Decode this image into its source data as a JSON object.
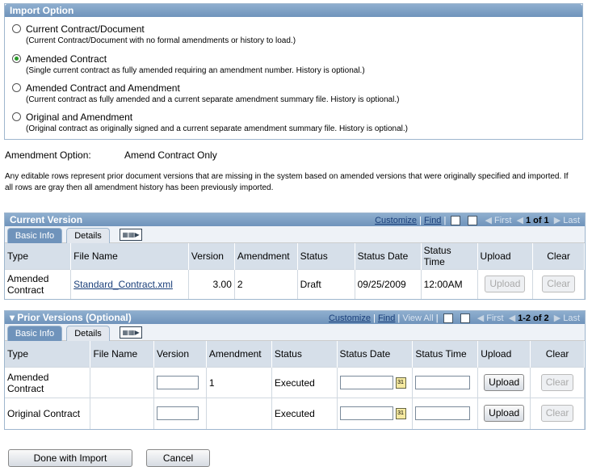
{
  "import_option": {
    "title": "Import Option",
    "options": [
      {
        "label": "Current Contract/Document",
        "desc": "(Current Contract/Document with no formal amendments or history to load.)",
        "selected": false
      },
      {
        "label": "Amended Contract",
        "desc": "(Single current contract as fully amended requiring an amendment number. History is optional.)",
        "selected": true
      },
      {
        "label": "Amended Contract and Amendment",
        "desc": "(Current contract as fully amended and a current separate amendment summary file. History is optional.)",
        "selected": false
      },
      {
        "label": "Original and Amendment",
        "desc": "(Original contract as originally signed and a current separate amendment summary file. History is optional.)",
        "selected": false
      }
    ]
  },
  "amendment_option": {
    "label": "Amendment Option:",
    "value": "Amend Contract Only"
  },
  "info_text": "Any editable rows represent prior document versions that are missing in the system based on amended versions that were originally specified and imported. If all rows are gray then all amendment history has been previously imported.",
  "current_version": {
    "title": "Current Version",
    "nav": {
      "customize": "Customize",
      "find": "Find",
      "first": "First",
      "count": "1 of 1",
      "last": "Last"
    },
    "tabs": {
      "basic": "Basic Info",
      "details": "Details"
    },
    "columns": [
      "Type",
      "File Name",
      "Version",
      "Amendment",
      "Status",
      "Status Date",
      "Status Time",
      "Upload",
      "Clear"
    ],
    "row": {
      "type": "Amended Contract",
      "file_name": "Standard_Contract.xml",
      "version": "3.00",
      "amendment": "2",
      "status": "Draft",
      "status_date": "09/25/2009",
      "status_time": "12:00AM",
      "upload": "Upload",
      "clear": "Clear"
    }
  },
  "prior_versions": {
    "title": "Prior Versions (Optional)",
    "nav": {
      "customize": "Customize",
      "find": "Find",
      "view_all": "View All",
      "first": "First",
      "count": "1-2 of 2",
      "last": "Last"
    },
    "tabs": {
      "basic": "Basic Info",
      "details": "Details"
    },
    "columns": [
      "Type",
      "File Name",
      "Version",
      "Amendment",
      "Status",
      "Status Date",
      "Status Time",
      "Upload",
      "Clear"
    ],
    "rows": [
      {
        "type": "Amended Contract",
        "amendment": "1",
        "status": "Executed",
        "upload": "Upload",
        "clear": "Clear"
      },
      {
        "type": "Original Contract",
        "amendment": "",
        "status": "Executed",
        "upload": "Upload",
        "clear": "Clear"
      }
    ]
  },
  "buttons": {
    "done": "Done with Import",
    "cancel": "Cancel"
  }
}
